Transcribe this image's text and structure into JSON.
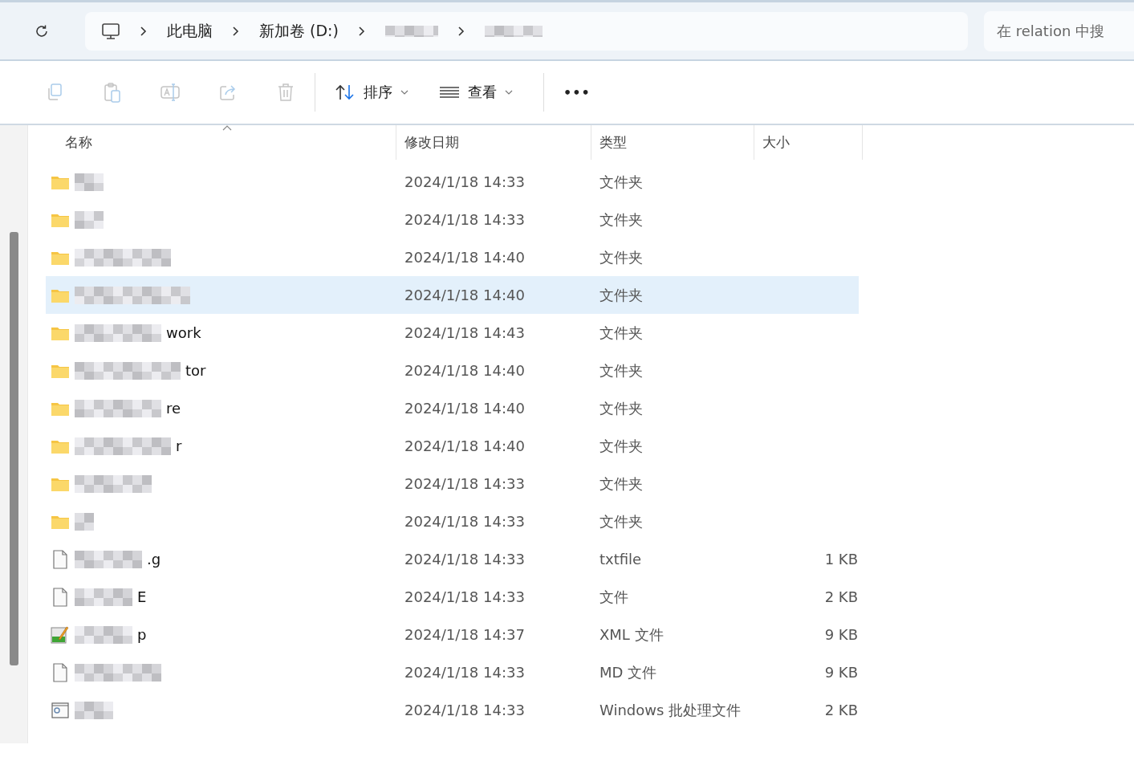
{
  "address_bar": {
    "crumbs": [
      {
        "kind": "computer"
      },
      {
        "kind": "text",
        "label": "此电脑"
      },
      {
        "kind": "text",
        "label": "新加卷 (D:)"
      },
      {
        "kind": "redacted"
      },
      {
        "kind": "redacted"
      }
    ]
  },
  "search": {
    "placeholder": "在 relation 中搜"
  },
  "toolbar": {
    "actions": [
      {
        "kind": "copy",
        "disabled": true
      },
      {
        "kind": "paste",
        "disabled": true
      },
      {
        "kind": "rename",
        "disabled": true
      },
      {
        "kind": "share",
        "disabled": true
      },
      {
        "kind": "delete",
        "disabled": true
      },
      {
        "kind": "sort",
        "label": "排序",
        "disabled": false
      },
      {
        "kind": "view",
        "label": "查看",
        "disabled": false
      },
      {
        "kind": "more",
        "label": "•••",
        "disabled": false
      }
    ]
  },
  "table": {
    "columns": [
      {
        "label": "名称",
        "sorted": true
      },
      {
        "label": "修改日期",
        "sorted": false
      },
      {
        "label": "类型",
        "sorted": false
      },
      {
        "label": "大小",
        "sorted": false
      }
    ],
    "rows": [
      {
        "kind": "folder",
        "redacted": true,
        "date": "2024/1/18 14:33",
        "type": "文件夹",
        "selected": false
      },
      {
        "kind": "folder",
        "redacted": true,
        "date": "2024/1/18 14:33",
        "type": "文件夹",
        "selected": false
      },
      {
        "kind": "folder",
        "redacted": true,
        "date": "2024/1/18 14:40",
        "type": "文件夹",
        "selected": false
      },
      {
        "kind": "folder",
        "redacted": true,
        "date": "2024/1/18 14:40",
        "type": "文件夹",
        "selected": true
      },
      {
        "kind": "folder",
        "name": "work",
        "redacted": true,
        "date": "2024/1/18 14:43",
        "type": "文件夹",
        "selected": false
      },
      {
        "kind": "folder",
        "name": "tor",
        "redacted": true,
        "date": "2024/1/18 14:40",
        "type": "文件夹",
        "selected": false
      },
      {
        "kind": "folder",
        "name": "re",
        "redacted": true,
        "date": "2024/1/18 14:40",
        "type": "文件夹",
        "selected": false
      },
      {
        "kind": "folder",
        "name": "r",
        "redacted": true,
        "date": "2024/1/18 14:40",
        "type": "文件夹",
        "selected": false
      },
      {
        "kind": "folder",
        "redacted": true,
        "date": "2024/1/18 14:33",
        "type": "文件夹",
        "selected": false
      },
      {
        "kind": "folder",
        "redacted": true,
        "date": "2024/1/18 14:33",
        "type": "文件夹",
        "selected": false
      },
      {
        "kind": "file",
        "name": ".g",
        "redacted": true,
        "date": "2024/1/18 14:33",
        "type": "txtfile",
        "size": "1 KB",
        "selected": false
      },
      {
        "kind": "file",
        "name": "E",
        "redacted": true,
        "date": "2024/1/18 14:33",
        "type": "文件",
        "size": "2 KB",
        "selected": false
      },
      {
        "kind": "xml",
        "name": "p",
        "redacted": true,
        "date": "2024/1/18 14:37",
        "type": "XML 文件",
        "size": "9 KB",
        "selected": false
      },
      {
        "kind": "file",
        "redacted": true,
        "date": "2024/1/18 14:33",
        "type": "MD 文件",
        "size": "9 KB",
        "selected": false
      },
      {
        "kind": "bat",
        "redacted": true,
        "date": "2024/1/18 14:33",
        "type": "Windows 批处理文件",
        "size": "2 KB",
        "selected": false
      }
    ]
  }
}
